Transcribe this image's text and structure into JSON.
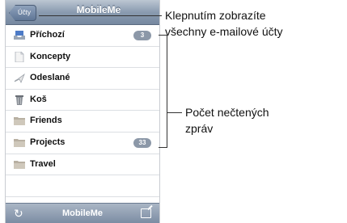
{
  "navbar": {
    "back_label": "Účty",
    "title": "MobileMe"
  },
  "mailboxes": [
    {
      "label": "Příchozí",
      "icon": "inbox-icon",
      "badge": "3"
    },
    {
      "label": "Koncepty",
      "icon": "drafts-icon",
      "badge": null
    },
    {
      "label": "Odeslané",
      "icon": "sent-icon",
      "badge": null
    },
    {
      "label": "Koš",
      "icon": "trash-icon",
      "badge": null
    },
    {
      "label": "Friends",
      "icon": "folder-icon",
      "badge": null
    },
    {
      "label": "Projects",
      "icon": "folder-icon",
      "badge": "33"
    },
    {
      "label": "Travel",
      "icon": "folder-icon",
      "badge": null
    }
  ],
  "toolbar": {
    "title": "MobileMe",
    "refresh_icon": "refresh-icon",
    "compose_icon": "compose-icon"
  },
  "callouts": {
    "accounts": [
      "Klepnutím zobrazíte",
      "všechny e-mailové účty"
    ],
    "unread": [
      "Počet nečtených",
      "zpráv"
    ]
  },
  "colors": {
    "navbar": "#8a9bb0",
    "badge": "#8c98a8",
    "folder": "#b8b0a2"
  }
}
